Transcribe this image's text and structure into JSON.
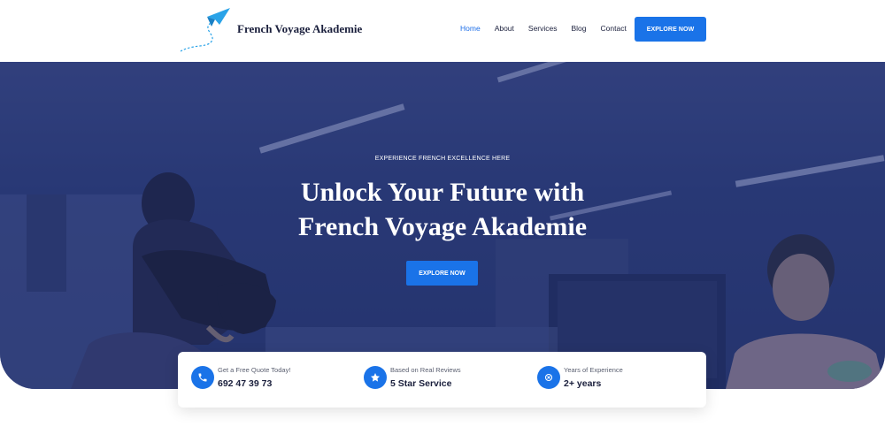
{
  "header": {
    "brand": "French Voyage Akademie",
    "nav": [
      {
        "label": "Home",
        "active": true
      },
      {
        "label": "About",
        "active": false
      },
      {
        "label": "Services",
        "active": false
      },
      {
        "label": "Blog",
        "active": false
      },
      {
        "label": "Contact",
        "active": false
      }
    ],
    "cta_label": "EXPLORE NOW"
  },
  "hero": {
    "eyebrow": "EXPERIENCE FRENCH EXCELLENCE HERE",
    "headline_line1": "Unlock Your Future with",
    "headline_line2": "French Voyage Akademie",
    "cta_label": "EXPLORE NOW"
  },
  "info": [
    {
      "icon": "phone-icon",
      "small": "Get a Free Quote Today!",
      "big": "692 47 39 73"
    },
    {
      "icon": "star-icon",
      "small": "Based on Real Reviews",
      "big": "5 Star Service"
    },
    {
      "icon": "award-icon",
      "small": "Years of Experience",
      "big": "2+ years"
    }
  ],
  "colors": {
    "accent": "#1a73e8",
    "navy": "#1a1f3c",
    "hero_overlay": "#2f3e7a"
  }
}
